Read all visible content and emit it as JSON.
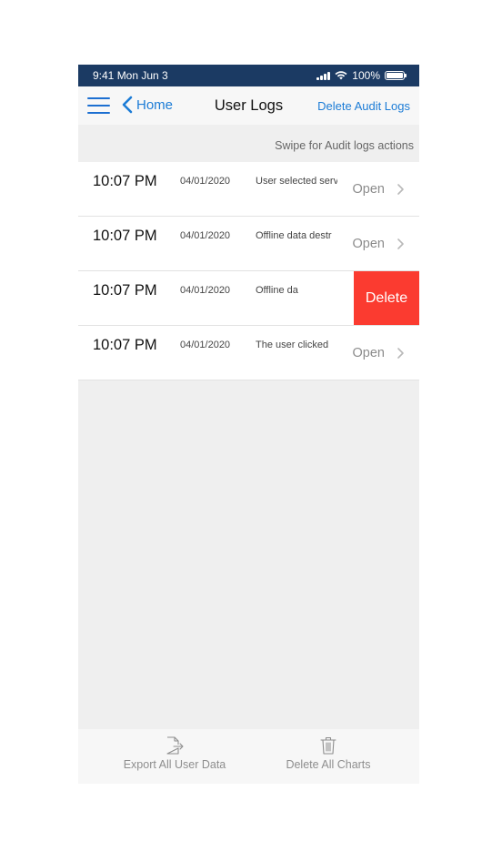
{
  "status_bar": {
    "time": "9:41 Mon Jun 3",
    "battery": "100%",
    "battery_level": 1.0
  },
  "nav": {
    "back_label": "Home",
    "title": "User Logs",
    "action_label": "Delete Audit Logs"
  },
  "hint": "Swipe for Audit logs actions",
  "rows": [
    {
      "time": "10:07 PM",
      "date": "04/01/2020",
      "message": "User selected serv",
      "action": "Open"
    },
    {
      "time": "10:07 PM",
      "date": "04/01/2020",
      "message": "Offline data destr",
      "action": "Open"
    },
    {
      "time": "10:07 PM",
      "date": "04/01/2020",
      "message": "Offline da",
      "action": "Delete"
    },
    {
      "time": "10:07 PM",
      "date": "04/01/2020",
      "message": "The user clicked",
      "action": "Open"
    }
  ],
  "tabs": {
    "export_label": "Export All User Data",
    "delete_label": "Delete All Charts"
  },
  "colors": {
    "status_bar": "#1b3a63",
    "accent": "#1c7cd6",
    "delete": "#fb3b30"
  }
}
